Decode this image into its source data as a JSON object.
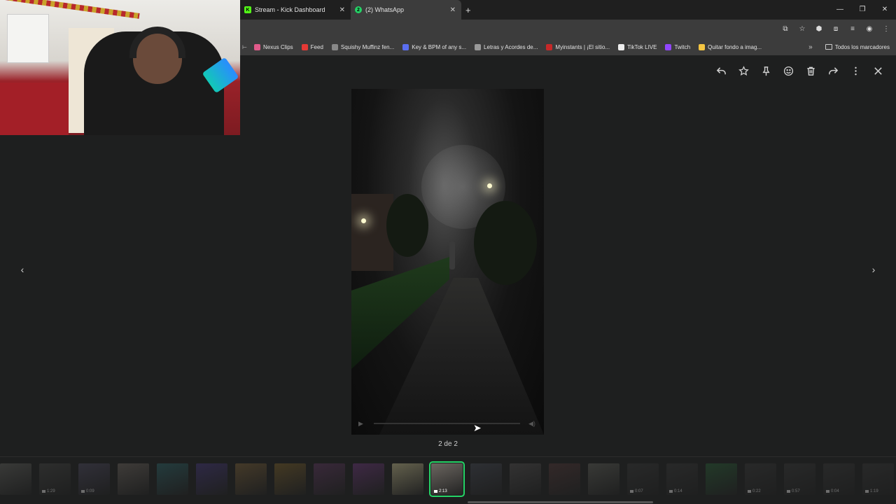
{
  "browser": {
    "tabs": [
      {
        "title": "Stream - Kick Dashboard",
        "favicon": "kick-icon",
        "color": "#53fc18",
        "active": false
      },
      {
        "title": "(2) WhatsApp",
        "favicon": "whatsapp-icon",
        "color": "#25d366",
        "active": true
      }
    ],
    "bookmarks": [
      {
        "label": "Nexus Clips",
        "color": "#e05a8a"
      },
      {
        "label": "Feed",
        "color": "#e53935"
      },
      {
        "label": "Squishy Muffinz fen...",
        "color": "#888888"
      },
      {
        "label": "Key & BPM of any s...",
        "color": "#5a6ef0"
      },
      {
        "label": "Letras y Acordes de...",
        "color": "#999999"
      },
      {
        "label": "Myinstants | ¡El sitio...",
        "color": "#c62828"
      },
      {
        "label": "TikTok LIVE",
        "color": "#eeeeee"
      },
      {
        "label": "Twitch",
        "color": "#9146ff"
      },
      {
        "label": "Quitar fondo a imag...",
        "color": "#f4c542"
      }
    ],
    "bookmarks_more": "»",
    "all_bookmarks": "Todos los marcadores"
  },
  "viewer": {
    "counter": "2 de 2",
    "toolbar": [
      "reply-icon",
      "star-icon",
      "pin-icon",
      "emoji-icon",
      "delete-icon",
      "forward-icon",
      "more-icon",
      "close-icon"
    ],
    "accent": "#25d366",
    "thumbnails": [
      {
        "color": "#6b6b66",
        "duration": ""
      },
      {
        "color": "#4a4a48",
        "duration": "1:29"
      },
      {
        "color": "#55506a",
        "duration": "0:09"
      },
      {
        "color": "#7a7068",
        "duration": ""
      },
      {
        "color": "#2e6f74",
        "duration": ""
      },
      {
        "color": "#4b3a8a",
        "duration": ""
      },
      {
        "color": "#8a6a3a",
        "duration": ""
      },
      {
        "color": "#8a6a2a",
        "duration": ""
      },
      {
        "color": "#6a3a6a",
        "duration": ""
      },
      {
        "color": "#7a3a8a",
        "duration": ""
      },
      {
        "color": "#6b6852",
        "duration": "",
        "near": true
      },
      {
        "color": "#6b6660",
        "duration": "2:13",
        "selected": true
      },
      {
        "color": "#4a4e5a",
        "duration": ""
      },
      {
        "color": "#5a5656",
        "duration": ""
      },
      {
        "color": "#5a3a3a",
        "duration": ""
      },
      {
        "color": "#6a6a62",
        "duration": ""
      },
      {
        "color": "#3c3c3c",
        "duration": "0:07"
      },
      {
        "color": "#3c3c3c",
        "duration": "0:14"
      },
      {
        "color": "#2a6a3a",
        "duration": ""
      },
      {
        "color": "#3c3c3c",
        "duration": "0:22"
      },
      {
        "color": "#3c3c3c",
        "duration": "0:57"
      },
      {
        "color": "#3c3c3c",
        "duration": "0:04"
      },
      {
        "color": "#3c3c3c",
        "duration": "1:19"
      }
    ]
  }
}
